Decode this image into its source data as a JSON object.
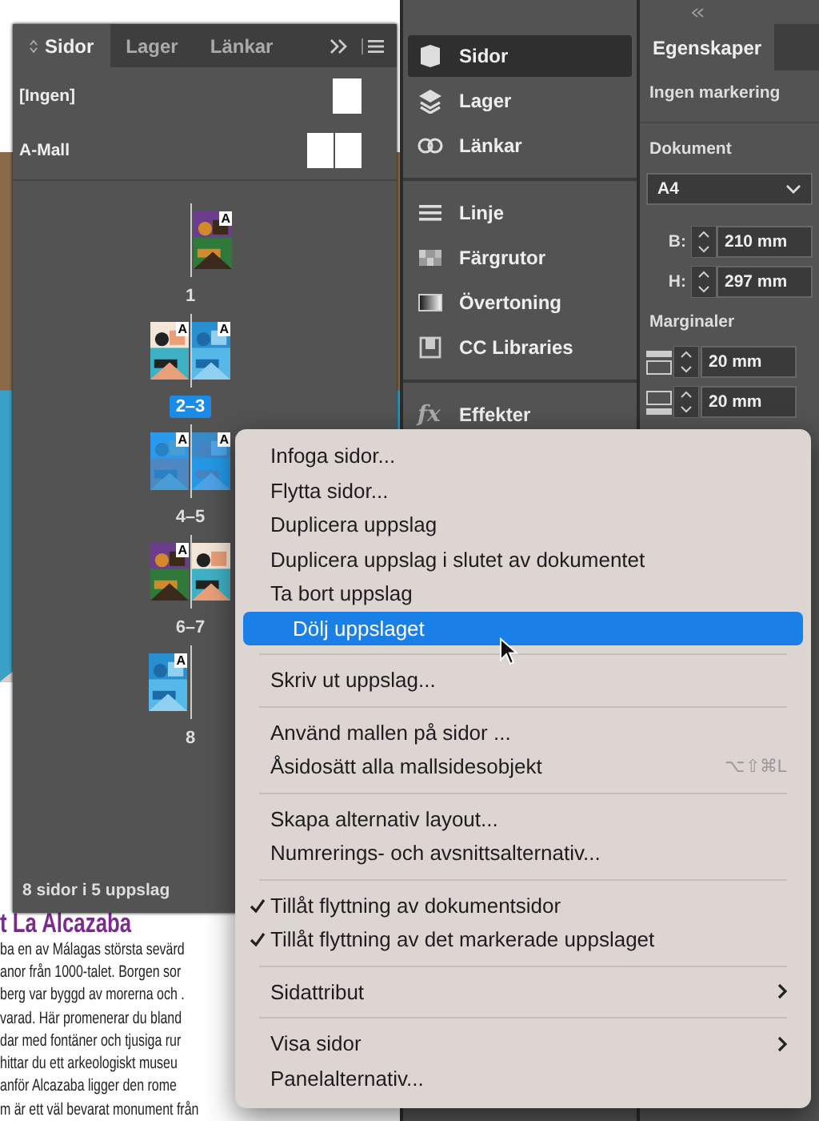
{
  "document": {
    "heading": "t La Alcazaba",
    "lines": [
      "ba en av Málagas största sevärd",
      "anor från 1000-talet. Borgen sor",
      "berg var byggd av morerna och .",
      "varad. Här promenerar du bland",
      "dar med fontäner och tjusiga rur",
      "hittar du ett arkeologiskt museu",
      "anför Alcazaba ligger den rome",
      "m är ett väl bevarat monument från"
    ]
  },
  "pages_panel": {
    "tabs": [
      {
        "label": "Sidor",
        "selected": true
      },
      {
        "label": "Lager",
        "selected": false
      },
      {
        "label": "Länkar",
        "selected": false
      }
    ],
    "masters": [
      {
        "label": "[Ingen]",
        "kind": "single"
      },
      {
        "label": "A-Mall",
        "kind": "spread"
      }
    ],
    "spreads": [
      {
        "label": "1",
        "kind": "right",
        "selected": false,
        "targeted": false,
        "pages": [
          {
            "kind": "page",
            "master": "A"
          }
        ]
      },
      {
        "label": "2–3",
        "kind": "pair",
        "selected": false,
        "targeted": true,
        "pages": [
          {
            "kind": "page",
            "master": "A"
          },
          {
            "kind": "page",
            "master": "A"
          }
        ]
      },
      {
        "label": "4–5",
        "kind": "pair",
        "selected": true,
        "targeted": false,
        "pages": [
          {
            "kind": "page",
            "master": "A"
          },
          {
            "kind": "page",
            "master": "A"
          }
        ]
      },
      {
        "label": "6–7",
        "kind": "pair",
        "selected": false,
        "targeted": false,
        "pages": [
          {
            "kind": "page",
            "master": "A"
          },
          {
            "kind": "page"
          }
        ]
      },
      {
        "label": "8",
        "kind": "left",
        "selected": false,
        "targeted": false,
        "pages": [
          {
            "kind": "page",
            "master": "A"
          }
        ]
      }
    ],
    "footer": "8 sidor i 5 uppslag"
  },
  "dock": {
    "groups": [
      [
        {
          "label": "Sidor",
          "selected": true
        },
        {
          "label": "Lager",
          "selected": false
        },
        {
          "label": "Länkar",
          "selected": false
        }
      ],
      [
        {
          "label": "Linje",
          "selected": false
        },
        {
          "label": "Färgrutor",
          "selected": false
        },
        {
          "label": "Övertoning",
          "selected": false
        },
        {
          "label": "CC Libraries",
          "selected": false
        }
      ],
      [
        {
          "label": "Effekter",
          "selected": false,
          "icon_text": "fx"
        }
      ]
    ]
  },
  "properties": {
    "tab": {
      "label": "Egenskaper",
      "selected": true
    },
    "selection": "Ingen markering",
    "section": "Dokument",
    "preset": "A4",
    "size_fields": [
      {
        "label": "B:",
        "value": "210 mm"
      },
      {
        "label": "H:",
        "value": "297 mm"
      }
    ],
    "margins_title": "Marginaler",
    "margin_fields": [
      {
        "kind": "top",
        "value": "20 mm"
      },
      {
        "kind": "bottom",
        "value": "20 mm"
      }
    ]
  },
  "context_menu": {
    "groups": [
      [
        {
          "label": "Infoga sidor...",
          "selected": false,
          "checked": false,
          "submenu": false
        },
        {
          "label": "Flytta sidor...",
          "selected": false,
          "checked": false,
          "submenu": false
        },
        {
          "label": "Duplicera uppslag",
          "selected": false,
          "checked": false,
          "submenu": false
        },
        {
          "label": "Duplicera uppslag i slutet av dokumentet",
          "selected": false,
          "checked": false,
          "submenu": false
        },
        {
          "label": "Ta bort uppslag",
          "selected": false,
          "checked": false,
          "submenu": false
        },
        {
          "label": "Dölj uppslaget",
          "selected": true,
          "checked": false,
          "submenu": false
        }
      ],
      [
        {
          "label": "Skriv ut uppslag...",
          "selected": false,
          "checked": false,
          "submenu": false
        }
      ],
      [
        {
          "label": "Använd mallen på sidor ...",
          "selected": false,
          "checked": false,
          "submenu": false
        },
        {
          "label": "Åsidosätt alla mallsidesobjekt",
          "selected": false,
          "checked": false,
          "submenu": false,
          "shortcut": "⌥⇧⌘L"
        }
      ],
      [
        {
          "label": "Skapa alternativ layout...",
          "selected": false,
          "checked": false,
          "submenu": false
        },
        {
          "label": "Numrerings- och avsnittsalternativ...",
          "selected": false,
          "checked": false,
          "submenu": false
        }
      ],
      [
        {
          "label": "Tillåt flyttning av dokumentsidor",
          "selected": false,
          "checked": true,
          "submenu": false
        },
        {
          "label": "Tillåt flyttning av det markerade uppslaget",
          "selected": false,
          "checked": true,
          "submenu": false
        }
      ],
      [
        {
          "label": "Sidattribut",
          "selected": false,
          "checked": false,
          "submenu": true
        }
      ],
      [
        {
          "label": "Visa sidor",
          "selected": false,
          "checked": false,
          "submenu": true
        },
        {
          "label": "Panelalternativ...",
          "selected": false,
          "checked": false,
          "submenu": false
        }
      ]
    ]
  }
}
